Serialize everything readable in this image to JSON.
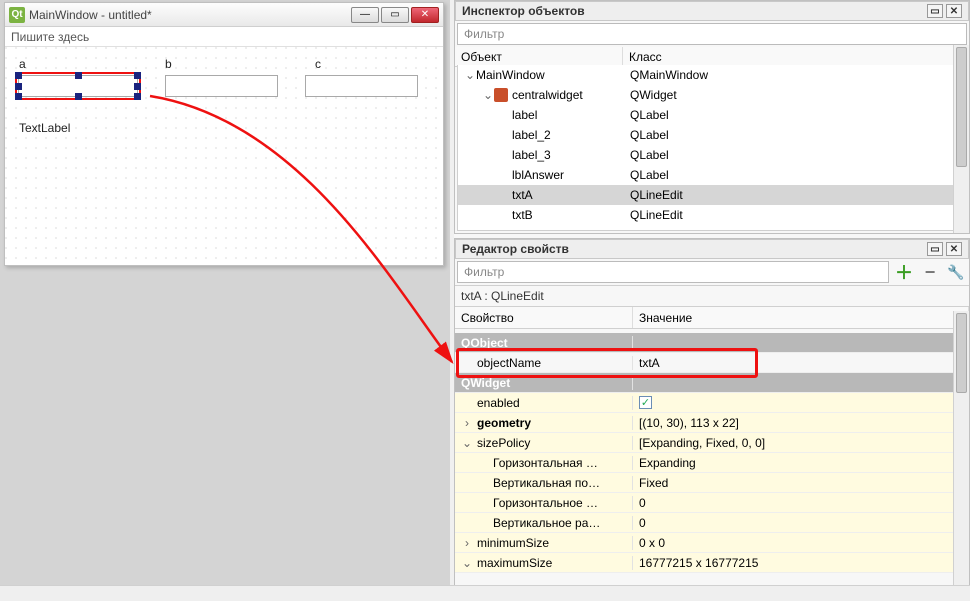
{
  "window": {
    "title": "MainWindow - untitled*",
    "menu_hint": "Пишите здесь",
    "labels": {
      "a": "a",
      "b": "b",
      "c": "c",
      "textlabel": "TextLabel"
    }
  },
  "inspector": {
    "title": "Инспектор объектов",
    "filter_placeholder": "Фильтр",
    "col_object": "Объект",
    "col_class": "Класс",
    "items": [
      {
        "name": "MainWindow",
        "cls": "QMainWindow",
        "depth": 0,
        "exp": "v"
      },
      {
        "name": "centralwidget",
        "cls": "QWidget",
        "depth": 1,
        "exp": "v",
        "icon": "red"
      },
      {
        "name": "label",
        "cls": "QLabel",
        "depth": 2
      },
      {
        "name": "label_2",
        "cls": "QLabel",
        "depth": 2
      },
      {
        "name": "label_3",
        "cls": "QLabel",
        "depth": 2
      },
      {
        "name": "lblAnswer",
        "cls": "QLabel",
        "depth": 2
      },
      {
        "name": "txtA",
        "cls": "QLineEdit",
        "depth": 2,
        "sel": true
      },
      {
        "name": "txtB",
        "cls": "QLineEdit",
        "depth": 2
      }
    ]
  },
  "props": {
    "title": "Редактор свойств",
    "filter_placeholder": "Фильтр",
    "caption": "txtA : QLineEdit",
    "col_prop": "Свойство",
    "col_val": "Значение",
    "rows": [
      {
        "k": "QObject",
        "group": true
      },
      {
        "k": "objectName",
        "v": "txtA",
        "highlight": true
      },
      {
        "k": "QWidget",
        "group": true
      },
      {
        "k": "enabled",
        "v_check": true,
        "yellow": true
      },
      {
        "k": "geometry",
        "v": "[(10, 30), 113 x 22]",
        "yellow": true,
        "exp": ">",
        "bold": true
      },
      {
        "k": "sizePolicy",
        "v": "[Expanding, Fixed, 0, 0]",
        "yellow": true,
        "exp": "v"
      },
      {
        "k": "Горизонтальная …",
        "v": "Expanding",
        "yellow": true,
        "indent": 2
      },
      {
        "k": "Вертикальная по…",
        "v": "Fixed",
        "yellow": true,
        "indent": 2
      },
      {
        "k": "Горизонтальное …",
        "v": "0",
        "yellow": true,
        "indent": 2
      },
      {
        "k": "Вертикальное ра…",
        "v": "0",
        "yellow": true,
        "indent": 2
      },
      {
        "k": "minimumSize",
        "v": "0 x 0",
        "yellow": true,
        "exp": ">"
      },
      {
        "k": "maximumSize",
        "v": "16777215 x 16777215",
        "yellow": true,
        "exp": "v"
      }
    ]
  }
}
